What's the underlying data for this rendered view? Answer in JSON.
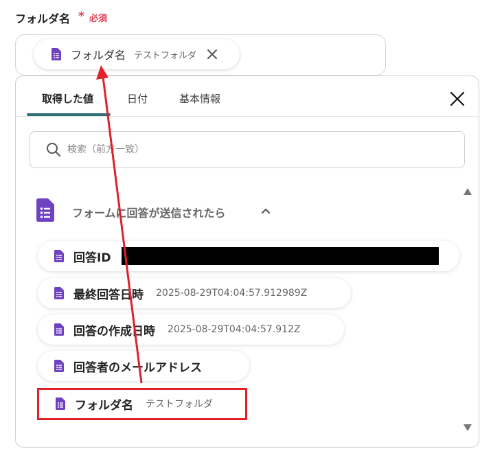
{
  "field": {
    "label": "フォルダ名",
    "required_mark": "*",
    "required_text": "必須"
  },
  "chip": {
    "label": "フォルダ名",
    "value": "テストフォルダ"
  },
  "tabs": [
    {
      "label": "取得した値",
      "active": true
    },
    {
      "label": "日付",
      "active": false
    },
    {
      "label": "基本情報",
      "active": false
    }
  ],
  "search": {
    "placeholder": "検索（前方一致）"
  },
  "section": {
    "title": "フォームに回答が送信されたら"
  },
  "items": [
    {
      "label": "回答ID",
      "value": "",
      "redacted": true
    },
    {
      "label": "最終回答日時",
      "value": "2025-08-29T04:04:57.912989Z"
    },
    {
      "label": "回答の作成日時",
      "value": "2025-08-29T04:04:57.912Z"
    },
    {
      "label": "回答者のメールアドレス",
      "value": ""
    },
    {
      "label": "フォルダ名",
      "value": "テストフォルダ",
      "highlighted": true
    }
  ],
  "colors": {
    "form_icon": "#6f42c1",
    "required": "#e0455a",
    "tab_accent": "#2f6d77",
    "annotation": "#e0202a"
  }
}
